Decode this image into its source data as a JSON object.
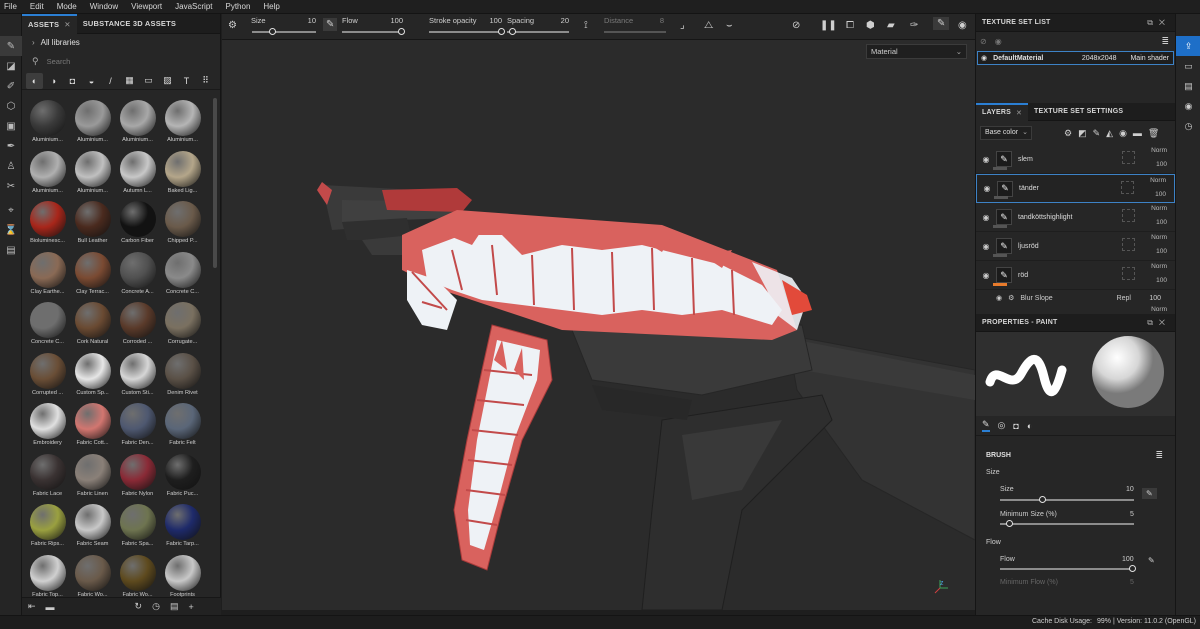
{
  "menu": [
    "File",
    "Edit",
    "Mode",
    "Window",
    "Viewport",
    "JavaScript",
    "Python",
    "Help"
  ],
  "assets": {
    "tabs": [
      {
        "label": "ASSETS",
        "close": "✕"
      },
      {
        "label": "SUBSTANCE 3D ASSETS"
      }
    ],
    "library": "All libraries",
    "search_placeholder": "Search",
    "materials": [
      {
        "label": "Aluminium...",
        "color": "#3a3a3a"
      },
      {
        "label": "Aluminium...",
        "color": "#9a9a9a"
      },
      {
        "label": "Aluminium...",
        "color": "#a8a8a8"
      },
      {
        "label": "Aluminium...",
        "color": "#b5b5b5"
      },
      {
        "label": "Aluminium...",
        "color": "#b0b0b0"
      },
      {
        "label": "Aluminium...",
        "color": "#c0c0c0"
      },
      {
        "label": "Autumn L...",
        "color": "#c8c8c8"
      },
      {
        "label": "Baked Lig...",
        "color": "#b4a68a"
      },
      {
        "label": "Bioluminesc...",
        "color": "#a8261a"
      },
      {
        "label": "Bull Leather",
        "color": "#4a2a1e"
      },
      {
        "label": "Carbon Fiber",
        "color": "#121212"
      },
      {
        "label": "Chipped P...",
        "color": "#6a5a4a"
      },
      {
        "label": "Clay Earthe...",
        "color": "#8a6a55"
      },
      {
        "label": "Clay Terrac...",
        "color": "#7a4a32"
      },
      {
        "label": "Concrete A...",
        "color": "#505050"
      },
      {
        "label": "Concrete C...",
        "color": "#8a8a8a"
      },
      {
        "label": "Concrete C...",
        "color": "#6e6e6e"
      },
      {
        "label": "Cork Natural",
        "color": "#6a4a32"
      },
      {
        "label": "Corroded ...",
        "color": "#5a3a2a"
      },
      {
        "label": "Corrugate...",
        "color": "#7a7060"
      },
      {
        "label": "Corrupted ...",
        "color": "#6a4e36"
      },
      {
        "label": "Custom Sp...",
        "color": "#e6e6e6"
      },
      {
        "label": "Custom Sti...",
        "color": "#d6d6d6"
      },
      {
        "label": "Denim Rivet",
        "color": "#5a5046"
      },
      {
        "label": "Embroidery",
        "color": "#e0e0e0"
      },
      {
        "label": "Fabric Cott...",
        "color": "#d27670"
      },
      {
        "label": "Fabric Den...",
        "color": "#4e5870"
      },
      {
        "label": "Fabric Felt",
        "color": "#5a6678"
      },
      {
        "label": "Fabric Lace",
        "color": "#3a3232"
      },
      {
        "label": "Fabric Linen",
        "color": "#8a8078"
      },
      {
        "label": "Fabric Nylon",
        "color": "#8a2a36"
      },
      {
        "label": "Fabric Puc...",
        "color": "#1e1e1e"
      },
      {
        "label": "Fabric Rips...",
        "color": "#9aa040"
      },
      {
        "label": "Fabric Seam",
        "color": "#c8c8c8"
      },
      {
        "label": "Fabric Spa...",
        "color": "#6e7450"
      },
      {
        "label": "Fabric Tarp...",
        "color": "#1e2a6a"
      },
      {
        "label": "Fabric Top...",
        "color": "#d0d0d0"
      },
      {
        "label": "Fabric Wo...",
        "color": "#6a5a4a"
      },
      {
        "label": "Fabric Wo...",
        "color": "#5e4a1e"
      },
      {
        "label": "Footprints",
        "color": "#c8c8c8"
      }
    ]
  },
  "toolbar": {
    "size_label": "Size",
    "size_value": "10",
    "flow_label": "Flow",
    "flow_value": "100",
    "stroke_label": "Stroke opacity",
    "stroke_value": "100",
    "spacing_label": "Spacing",
    "spacing_value": "20",
    "distance_label": "Distance",
    "distance_value": "8"
  },
  "viewport": {
    "material_select": "Material"
  },
  "texture_set_list": {
    "title": "TEXTURE SET LIST",
    "material_name": "DefaultMaterial",
    "resolution": "2048x2048",
    "shader": "Main shader"
  },
  "layers_panel": {
    "tabs": [
      {
        "label": "LAYERS"
      },
      {
        "label": "TEXTURE SET SETTINGS"
      }
    ],
    "channel": "Base color",
    "layers": [
      {
        "name": "slem",
        "mode": "Norm",
        "opacity": "100"
      },
      {
        "name": "tänder",
        "mode": "Norm",
        "opacity": "100"
      },
      {
        "name": "tandköttshighlight",
        "mode": "Norm",
        "opacity": "100"
      },
      {
        "name": "ljusröd",
        "mode": "Norm",
        "opacity": "100"
      },
      {
        "name": "röd",
        "mode": "Norm",
        "opacity": "100"
      }
    ],
    "effect": {
      "name": "Blur Slope",
      "mode": "Repl",
      "opacity": "100"
    },
    "partial_mode": "Norm"
  },
  "properties": {
    "title": "PROPERTIES - PAINT",
    "section": "BRUSH",
    "size_group": "Size",
    "size_label": "Size",
    "size_value": "10",
    "min_size_label": "Minimum Size (%)",
    "min_size_value": "5",
    "flow_group": "Flow",
    "flow_label": "Flow",
    "flow_value": "100",
    "min_flow_label": "Minimum Flow (%)",
    "min_flow_value": "5"
  },
  "status": {
    "cache": "Cache Disk Usage:",
    "cache_value": "99%",
    "version": "| Version: 11.0.2 (OpenGL)"
  }
}
